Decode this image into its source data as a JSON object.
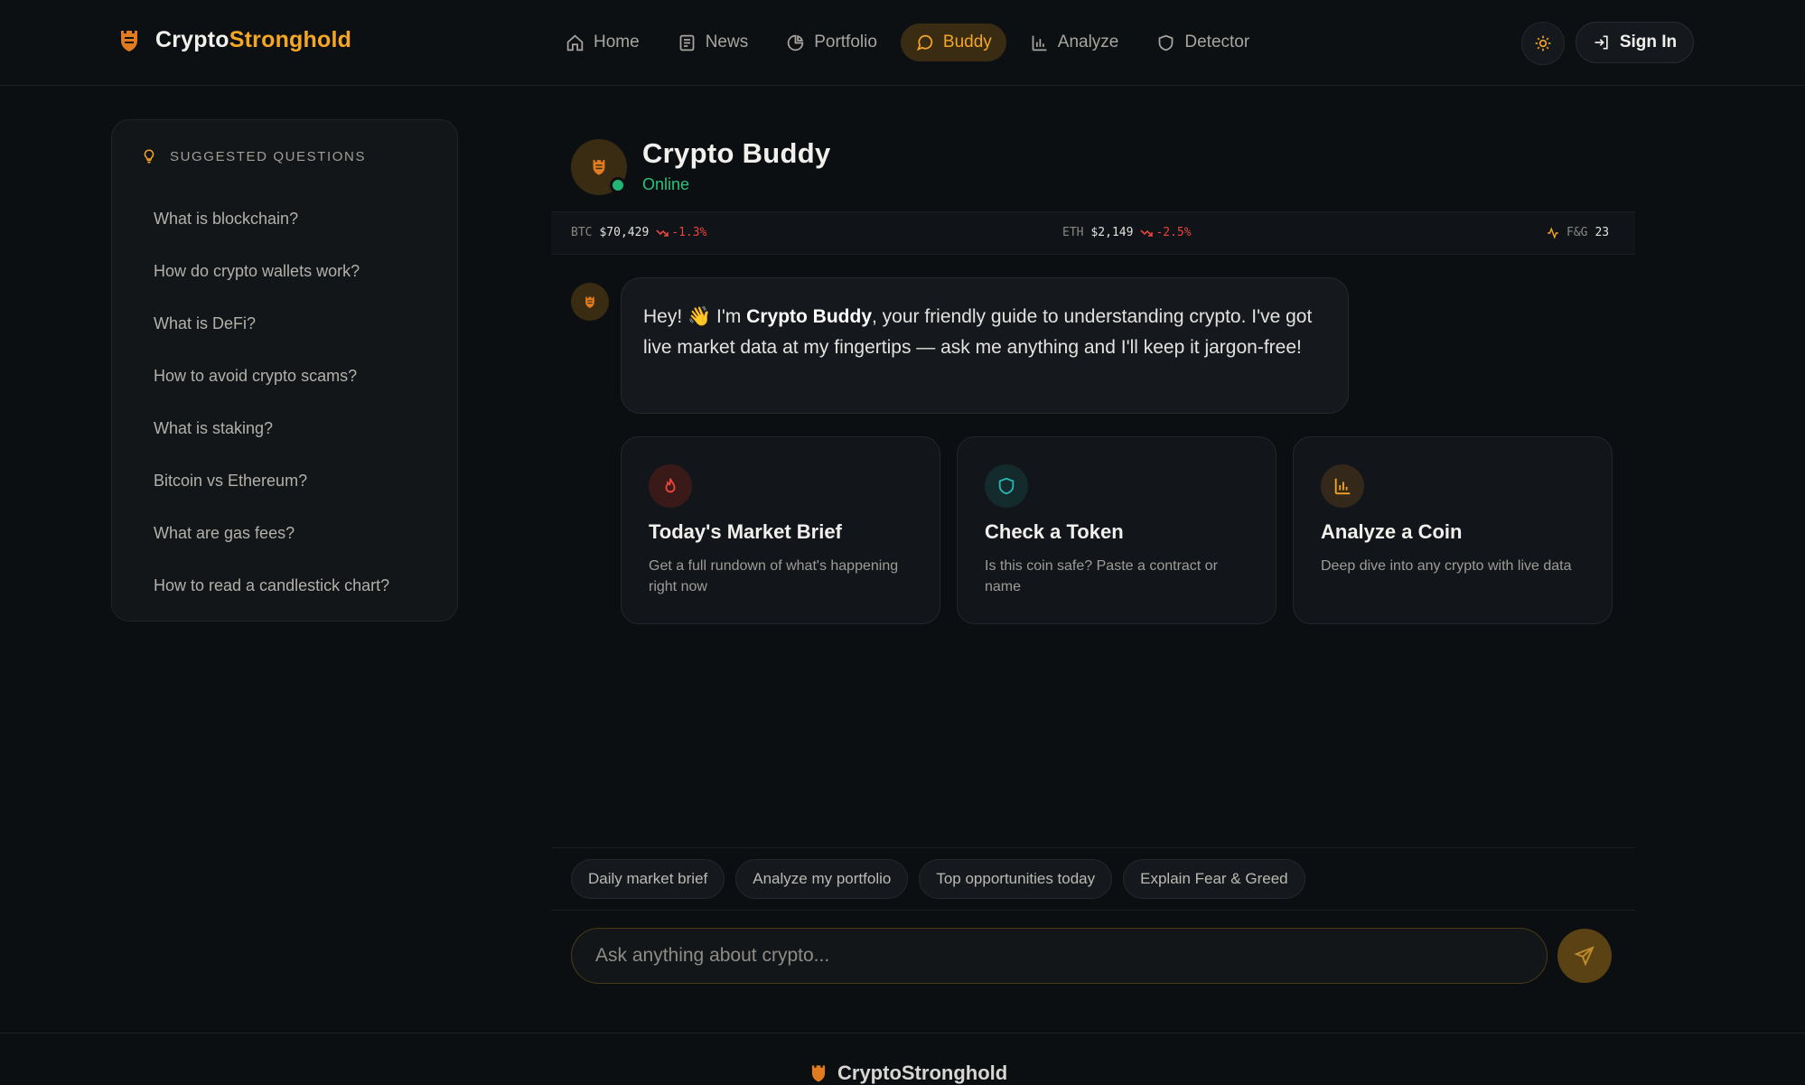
{
  "brand": {
    "name_part1": "Crypto",
    "name_part2": "Stronghold",
    "logo_icon": "shield-crest-icon"
  },
  "nav": {
    "items": [
      {
        "label": "Home",
        "icon": "home-icon"
      },
      {
        "label": "News",
        "icon": "newspaper-icon"
      },
      {
        "label": "Portfolio",
        "icon": "pie-chart-icon"
      },
      {
        "label": "Buddy",
        "icon": "chat-bubble-icon",
        "active": true
      },
      {
        "label": "Analyze",
        "icon": "bar-chart-icon"
      },
      {
        "label": "Detector",
        "icon": "shield-icon"
      }
    ],
    "theme_toggle_icon": "sun-icon",
    "signin_label": "Sign In"
  },
  "sidebar": {
    "title": "Suggested Questions",
    "questions": [
      "What is blockchain?",
      "How do crypto wallets work?",
      "What is DeFi?",
      "How to avoid crypto scams?",
      "What is staking?",
      "Bitcoin vs Ethereum?",
      "What are gas fees?",
      "How to read a candlestick chart?"
    ]
  },
  "chat": {
    "name": "Crypto Buddy",
    "status": "Online",
    "ticker": {
      "btc": {
        "symbol": "BTC",
        "price": "$70,429",
        "change": "-1.3%"
      },
      "eth": {
        "symbol": "ETH",
        "price": "$2,149",
        "change": "-2.5%"
      },
      "fng": {
        "symbol": "F&G",
        "value": "23"
      }
    },
    "greeting": {
      "part1": "Hey! 👋 I'm ",
      "bold": "Crypto Buddy",
      "part2": ", your friendly guide to understanding crypto. I've got live market data at my fingertips — ask me anything and I'll keep it jargon-free!"
    },
    "cards": [
      {
        "title": "Today's Market Brief",
        "desc": "Get a full rundown of what's happening right now",
        "icon": "flame-icon",
        "color": "#e8453c"
      },
      {
        "title": "Check a Token",
        "desc": "Is this coin safe? Paste a contract or name",
        "icon": "shield-icon",
        "color": "#2bb5b0"
      },
      {
        "title": "Analyze a Coin",
        "desc": "Deep dive into any crypto with live data",
        "icon": "bar-chart-icon",
        "color": "#f5a623"
      }
    ],
    "chips": [
      "Daily market brief",
      "Analyze my portfolio",
      "Top opportunities today",
      "Explain Fear & Greed"
    ],
    "input_placeholder": "Ask anything about crypto...",
    "send_icon": "send-icon"
  },
  "footer": {
    "brand_name": "CryptoStronghold"
  },
  "colors": {
    "accent": "#f5a623",
    "online": "#2bc27c",
    "negative": "#e8453c",
    "background": "#0c0f12"
  }
}
